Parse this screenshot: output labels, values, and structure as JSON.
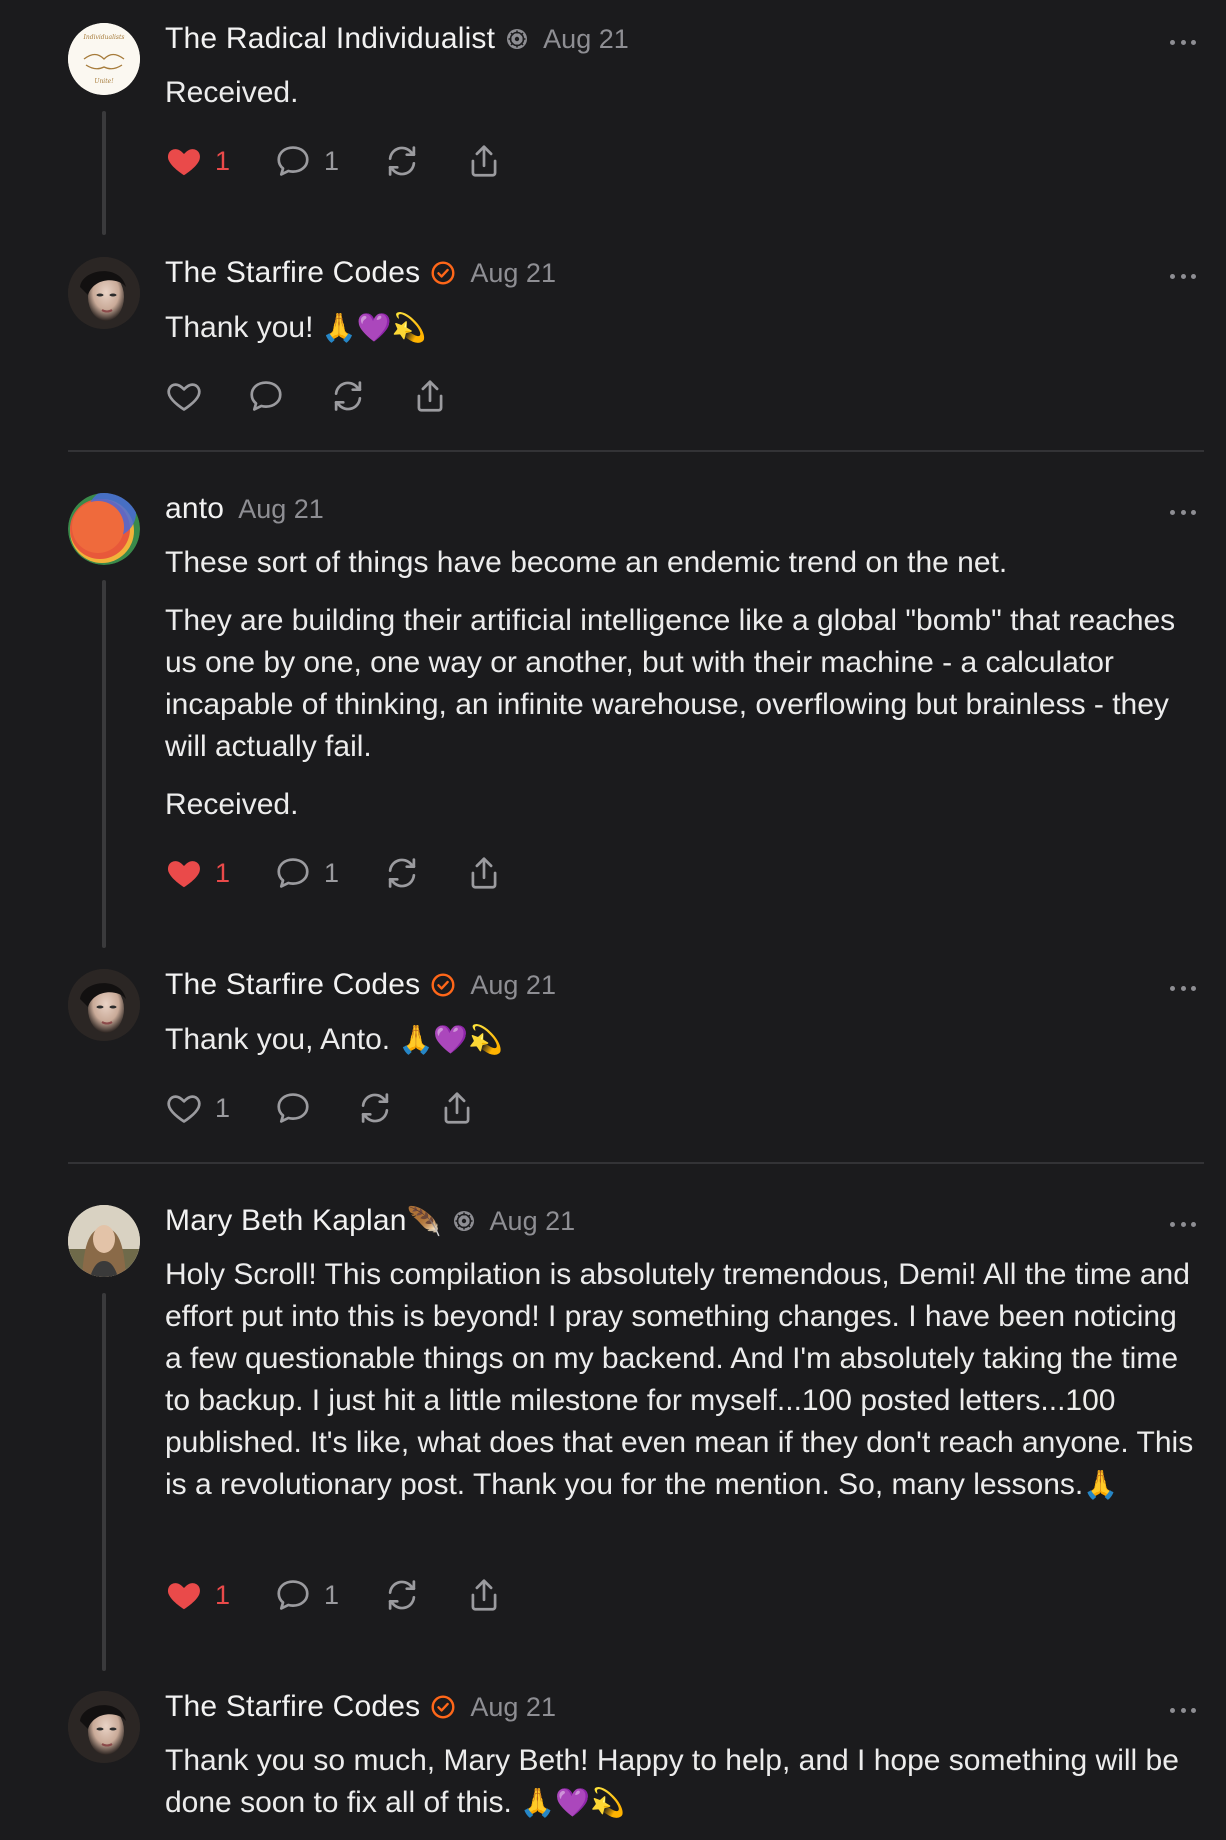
{
  "comments": [
    {
      "author": "The Radical Individualist",
      "date": "Aug 21",
      "paragraphs": [
        "Received."
      ],
      "likes": "1",
      "replies": "1",
      "avatar_text": [
        "Individualists",
        "Unite!"
      ]
    },
    {
      "author": "The Starfire Codes",
      "date": "Aug 21",
      "text": "Thank you!",
      "emoji": "🙏💜💫"
    },
    {
      "author": "anto",
      "date": "Aug 21",
      "paragraphs": [
        "These sort of things have become an endemic trend on the net.",
        "They are building their artificial intelligence like a global \"bomb\" that reaches us one by one, one way or another, but with their machine - a calculator incapable of thinking, an infinite warehouse, overflowing but brainless - they will actually fail.",
        "Received."
      ],
      "likes": "1",
      "replies": "1"
    },
    {
      "author": "The Starfire Codes",
      "date": "Aug 21",
      "text": "Thank you, Anto.",
      "emoji": "🙏💜💫",
      "likes": "1"
    },
    {
      "author": "Mary Beth Kaplan",
      "author_emoji": "🪶",
      "date": "Aug 21",
      "text": "Holy Scroll! This compilation is absolutely tremendous, Demi! All the time and effort put into this is beyond! I pray something changes. I have been noticing a few questionable things on my backend. And I'm absolutely taking the time to backup. I just hit a little milestone for myself...100 posted letters...100 published. It's like, what does that even mean if they don't reach anyone. This is a revolutionary post. Thank you for the mention. So, many lessons.",
      "emoji": "🙏",
      "likes": "1",
      "replies": "1"
    },
    {
      "author": "The Starfire Codes",
      "date": "Aug 21",
      "text": "Thank you so much, Mary Beth! Happy to help, and I hope something will be done soon to fix all of this.",
      "emoji": "🙏💜💫"
    }
  ],
  "colors": {
    "background": "#1b1b1d",
    "like_active": "#ea4a4a",
    "verified_badge": "#ff6719",
    "muted": "#8e8e93"
  },
  "icons": [
    "heart-icon",
    "comment-icon",
    "restack-icon",
    "share-icon",
    "more-icon",
    "verified-icon",
    "subscriber-icon"
  ]
}
